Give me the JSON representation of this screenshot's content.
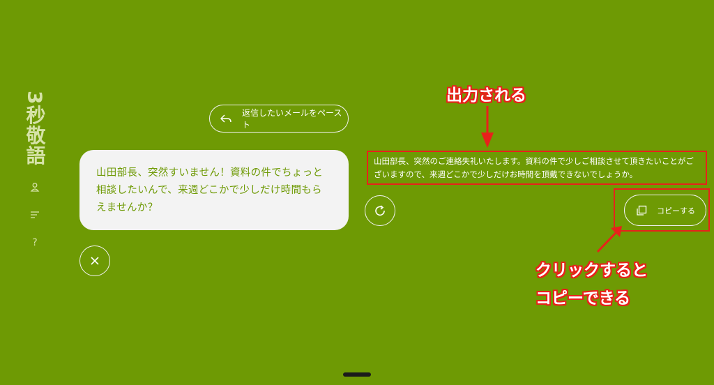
{
  "app": {
    "brand": "3秒敬語"
  },
  "sidebar": {
    "icons": [
      "user-icon",
      "list-icon",
      "help-icon"
    ],
    "help_glyph": "?"
  },
  "paste_button": {
    "label": "返信したいメールをペースト",
    "icon": "reply-icon"
  },
  "input": {
    "text": "山田部長、突然すいません！資料の件でちょっと相談したいんで、来週どこかで少しだけ時間もらえませんか？"
  },
  "output": {
    "text": "山田部長、突然のご連絡失礼いたします。資料の件で少しご相談させて頂きたいことがございますので、来週どこかで少しだけお時間を頂戴できないでしょうか。"
  },
  "copy_button": {
    "label": "コピーする",
    "icon": "copy-icon"
  },
  "annotations": {
    "output_note": "出力される",
    "copy_note_line1": "クリックすると",
    "copy_note_line2": "コピーできる"
  },
  "colors": {
    "background": "#6e9a04",
    "accent_red": "#e8211b",
    "card": "#f3f3f3"
  }
}
